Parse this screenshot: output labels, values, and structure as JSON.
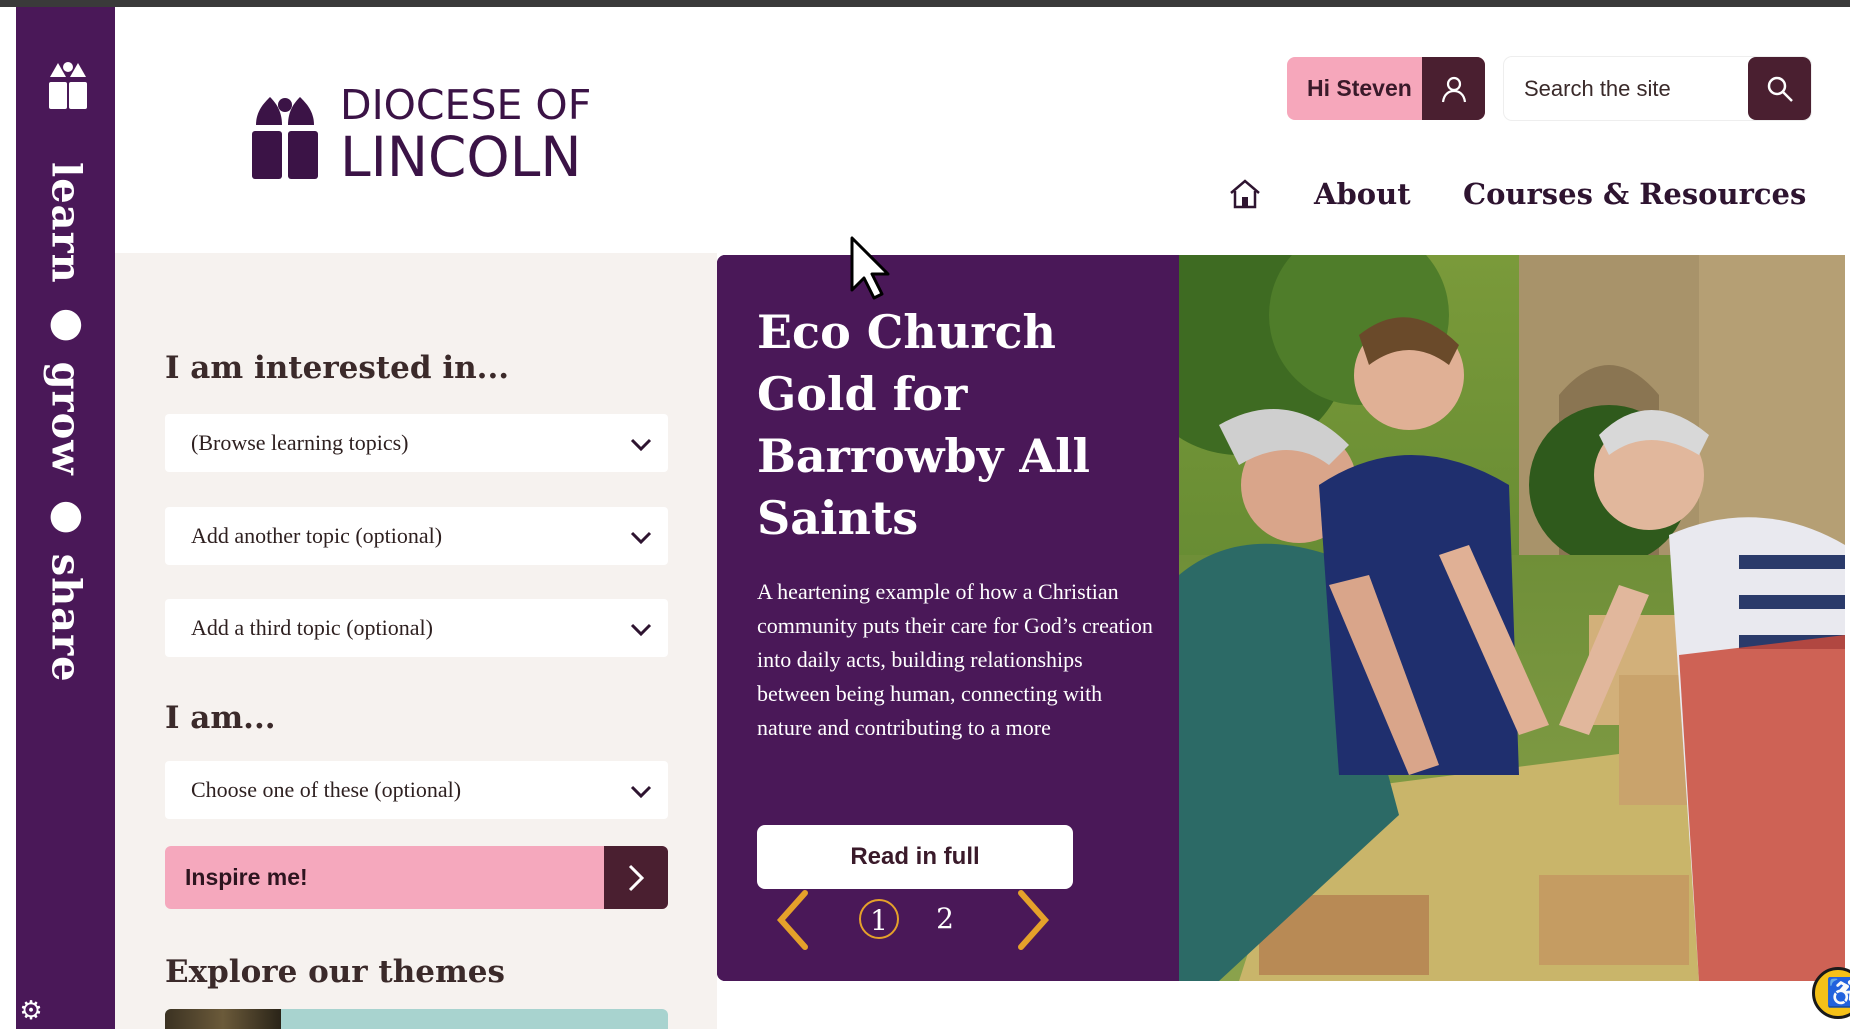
{
  "sidebar": {
    "tagline": "learn ● grow ● share"
  },
  "brand": {
    "line1": "DIOCESE OF",
    "line2": "LINCOLN"
  },
  "filters": {
    "heading_interest": "I am interested in...",
    "topic1": "(Browse learning topics)",
    "topic2": "Add another topic (optional)",
    "topic3": "Add a third topic (optional)",
    "heading_iam": "I am...",
    "role": "Choose one of these (optional)",
    "inspire_label": "Inspire me!",
    "themes_heading": "Explore our themes"
  },
  "header": {
    "greeting": "Hi Steven",
    "search_placeholder": "Search the site",
    "nav": {
      "about": "About",
      "courses": "Courses & Resources"
    }
  },
  "hero": {
    "title": "Eco Church Gold for Barrowby All Saints",
    "text": "A heartening example of how a Christian community puts their care for God’s creation into daily acts, building relationships between being human, connecting with nature and contributing to a more",
    "button": "Read in full",
    "pages": [
      "1",
      "2"
    ],
    "current_page": 1
  },
  "colors": {
    "brand_purple": "#4a1858",
    "pink": "#f5a8bd",
    "dark_plum": "#4a1f30",
    "accent_gold": "#e5a12a"
  },
  "icons": [
    "church-icon",
    "settings-icon",
    "chevron-down-icon",
    "arrow-right-icon",
    "user-icon",
    "search-icon",
    "home-icon",
    "chevron-left-icon",
    "chevron-right-icon",
    "accessibility-icon"
  ]
}
